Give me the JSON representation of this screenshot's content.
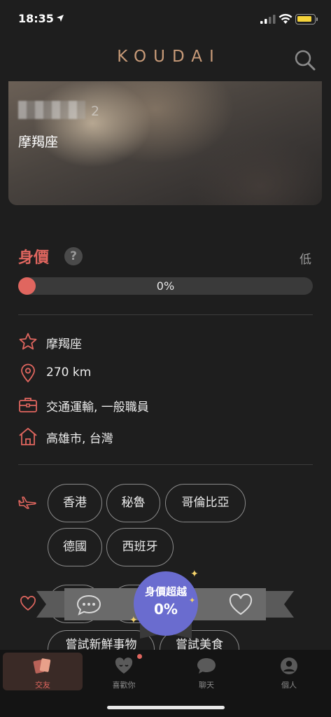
{
  "status_bar": {
    "time": "18:35",
    "battery_color": "#f5d33a"
  },
  "header": {
    "logo": "KOUDAI",
    "search_icon": "search-icon"
  },
  "profile": {
    "name_redacted": true,
    "age_suffix": "2",
    "photo_sign": "摩羯座"
  },
  "value": {
    "title": "身價",
    "help": "?",
    "level": "低",
    "progress_percent": 0,
    "progress_text": "0%"
  },
  "info": [
    {
      "icon": "star-icon",
      "text": "摩羯座"
    },
    {
      "icon": "location-pin-icon",
      "text": "270 km"
    },
    {
      "icon": "briefcase-icon",
      "text": "交通運輸, 一般職員"
    },
    {
      "icon": "house-icon",
      "text": "高雄市, 台灣"
    }
  ],
  "travel": {
    "icon": "plane-icon",
    "chips": [
      "香港",
      "秘魯",
      "哥倫比亞",
      "德國",
      "西班牙"
    ]
  },
  "interests": {
    "icon": "heart-icon",
    "chips_partial": [
      "嘗試新鮮事物",
      "嘗試美食"
    ]
  },
  "banner": {
    "badge_title": "身價超越",
    "badge_value": "0%",
    "left_icon": "chat-bubble-icon",
    "right_icon": "heart-outline-icon"
  },
  "nav": {
    "items": [
      {
        "label": "交友",
        "icon": "cards-icon",
        "active": true
      },
      {
        "label": "喜歡你",
        "icon": "liked-heart-icon",
        "active": false
      },
      {
        "label": "聊天",
        "icon": "chat-icon",
        "active": false
      },
      {
        "label": "個人",
        "icon": "profile-icon",
        "active": false
      }
    ]
  },
  "colors": {
    "accent": "#e0665f",
    "badge": "#6a6ccf",
    "logo": "#c79a78",
    "background": "#1e1e1e"
  }
}
